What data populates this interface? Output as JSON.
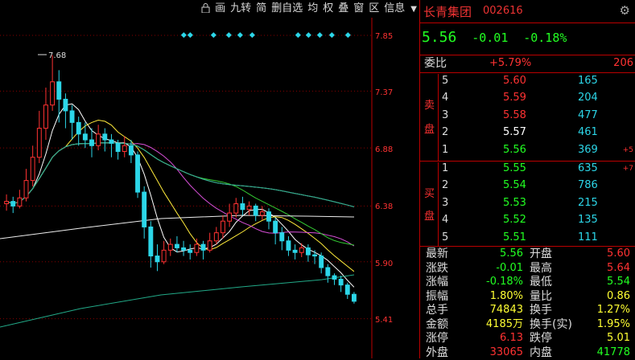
{
  "toolbar": {
    "items": [
      "画",
      "九转",
      "简",
      "删自选",
      "均",
      "权",
      "叠",
      "窗",
      "区",
      "信息"
    ],
    "lock_icon": "lock-icon",
    "menu_arrow": "▼"
  },
  "chart": {
    "price_labels": [
      "7.85",
      "7.37",
      "6.88",
      "6.38",
      "5.90",
      "5.41"
    ],
    "high_marker": "7.68"
  },
  "stock": {
    "name": "长青集团",
    "code": "002616",
    "price": "5.56",
    "change": "-0.01",
    "change_pct": "-0.18%"
  },
  "weibi": {
    "label": "委比",
    "pct": "+5.79%",
    "diff": "206"
  },
  "sell_label": [
    "卖",
    "盘"
  ],
  "buy_label": [
    "买",
    "盘"
  ],
  "sell": [
    {
      "lvl": "5",
      "price": "5.60",
      "vol": "165",
      "chg": ""
    },
    {
      "lvl": "4",
      "price": "5.59",
      "vol": "204",
      "chg": ""
    },
    {
      "lvl": "3",
      "price": "5.58",
      "vol": "477",
      "chg": ""
    },
    {
      "lvl": "2",
      "price": "5.57",
      "vol": "461",
      "chg": ""
    },
    {
      "lvl": "1",
      "price": "5.56",
      "vol": "369",
      "chg": "+5"
    }
  ],
  "buy": [
    {
      "lvl": "1",
      "price": "5.55",
      "vol": "635",
      "chg": "+7"
    },
    {
      "lvl": "2",
      "price": "5.54",
      "vol": "786",
      "chg": ""
    },
    {
      "lvl": "3",
      "price": "5.53",
      "vol": "215",
      "chg": ""
    },
    {
      "lvl": "4",
      "price": "5.52",
      "vol": "135",
      "chg": ""
    },
    {
      "lvl": "5",
      "price": "5.51",
      "vol": "111",
      "chg": ""
    }
  ],
  "stats": [
    {
      "l1": "最新",
      "v1": "5.56",
      "c1": "green",
      "l2": "开盘",
      "v2": "5.60",
      "c2": "red"
    },
    {
      "l1": "涨跌",
      "v1": "-0.01",
      "c1": "green",
      "l2": "最高",
      "v2": "5.64",
      "c2": "red"
    },
    {
      "l1": "涨幅",
      "v1": "-0.18%",
      "c1": "green",
      "l2": "最低",
      "v2": "5.54",
      "c2": "green"
    },
    {
      "l1": "振幅",
      "v1": "1.80%",
      "c1": "yellow",
      "l2": "量比",
      "v2": "0.86",
      "c2": "yellow"
    },
    {
      "l1": "总手",
      "v1": "74843",
      "c1": "yellow",
      "l2": "换手",
      "v2": "1.27%",
      "c2": "yellow"
    },
    {
      "l1": "金额",
      "v1": "4185万",
      "c1": "yellow",
      "l2": "换手(实)",
      "v2": "1.95%",
      "c2": "yellow"
    },
    {
      "l1": "涨停",
      "v1": "6.13",
      "c1": "red",
      "l2": "跌停",
      "v2": "5.01",
      "c2": "yellow"
    },
    {
      "l1": "外盘",
      "v1": "33065",
      "c1": "red",
      "l2": "内盘",
      "v2": "41778",
      "c2": "green"
    }
  ],
  "colors": {
    "up": "#ff3232",
    "down": "#2cd6e8",
    "flat": "#2f2",
    "grid": "#b00"
  }
}
